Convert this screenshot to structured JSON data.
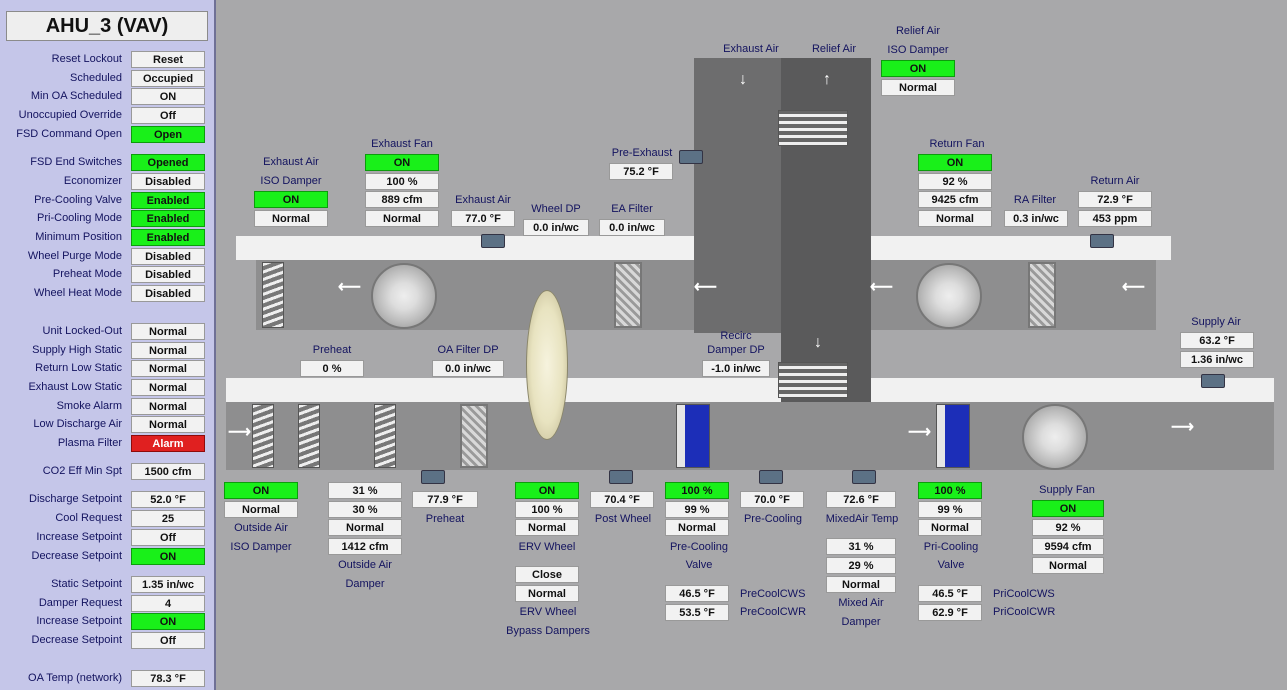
{
  "title": "AHU_3 (VAV)",
  "left": [
    {
      "label": "Reset Lockout",
      "value": "Reset",
      "style": "btn"
    },
    {
      "label": "Scheduled",
      "value": "Occupied",
      "style": "normal"
    },
    {
      "label": "Min OA Scheduled",
      "value": "ON",
      "style": "normal"
    },
    {
      "label": "Unoccupied Override",
      "value": "Off",
      "style": "normal"
    },
    {
      "label": "FSD Command Open",
      "value": "Open",
      "style": "green"
    },
    {
      "label": "FSD End Switches",
      "value": "Opened",
      "style": "green"
    },
    {
      "label": "Economizer",
      "value": "Disabled",
      "style": "normal"
    },
    {
      "label": "Pre-Cooling Valve",
      "value": "Enabled",
      "style": "green"
    },
    {
      "label": "Pri-Cooling Mode",
      "value": "Enabled",
      "style": "green"
    },
    {
      "label": "Minimum Position",
      "value": "Enabled",
      "style": "green"
    },
    {
      "label": "Wheel Purge Mode",
      "value": "Disabled",
      "style": "normal"
    },
    {
      "label": "Preheat Mode",
      "value": "Disabled",
      "style": "normal"
    },
    {
      "label": "Wheel Heat Mode",
      "value": "Disabled",
      "style": "normal"
    },
    {
      "label": "Unit Locked-Out",
      "value": "Normal",
      "style": "normal"
    },
    {
      "label": "Supply High Static",
      "value": "Normal",
      "style": "normal"
    },
    {
      "label": "Return Low Static",
      "value": "Normal",
      "style": "normal"
    },
    {
      "label": "Exhaust Low Static",
      "value": "Normal",
      "style": "normal"
    },
    {
      "label": "Smoke Alarm",
      "value": "Normal",
      "style": "normal"
    },
    {
      "label": "Low Discharge Air",
      "value": "Normal",
      "style": "normal"
    },
    {
      "label": "Plasma Filter",
      "value": "Alarm",
      "style": "red"
    },
    {
      "label": "CO2 Eff Min Spt",
      "value": "1500 cfm",
      "style": "normal"
    },
    {
      "label": "Discharge Setpoint",
      "value": "52.0 °F",
      "style": "normal"
    },
    {
      "label": "Cool Request",
      "value": "25",
      "style": "normal"
    },
    {
      "label": "Increase Setpoint",
      "value": "Off",
      "style": "normal"
    },
    {
      "label": "Decrease Setpoint",
      "value": "ON",
      "style": "green"
    },
    {
      "label": "Static Setpoint",
      "value": "1.35 in/wc",
      "style": "normal"
    },
    {
      "label": "Damper Request",
      "value": "4",
      "style": "normal"
    },
    {
      "label": "Increase Setpoint",
      "value": "ON",
      "style": "green"
    },
    {
      "label": "Decrease Setpoint",
      "value": "Off",
      "style": "normal"
    },
    {
      "label": "OA Temp (network)",
      "value": "78.3 °F",
      "style": "normal"
    }
  ],
  "diagram": {
    "labels": {
      "exhaust_air_col": "Exhaust Air",
      "relief_air_col": "Relief Air",
      "relief_iso_1": "Relief Air",
      "relief_iso_2": "ISO Damper",
      "exhaust_iso_1": "Exhaust Air",
      "exhaust_iso_2": "ISO Damper",
      "exhaust_fan": "Exhaust Fan",
      "exhaust_air_temp": "Exhaust Air",
      "wheel_dp": "Wheel DP",
      "ea_filter": "EA Filter",
      "pre_exhaust": "Pre-Exhaust",
      "return_fan": "Return Fan",
      "ra_filter": "RA Filter",
      "return_air": "Return Air",
      "supply_air": "Supply Air",
      "preheat_top": "Preheat",
      "oa_filter_dp": "OA Filter DP",
      "recirc_dp_1": "Recirc",
      "recirc_dp_2": "Damper DP",
      "outside_air_iso_1": "Outside Air",
      "outside_air_iso_2": "ISO Damper",
      "outside_air_damper_1": "Outside Air",
      "outside_air_damper_2": "Damper",
      "preheat_bottom": "Preheat",
      "erv_wheel": "ERV Wheel",
      "post_wheel": "Post Wheel",
      "pre_cooling_valve_1": "Pre-Cooling",
      "pre_cooling_valve_2": "Valve",
      "pre_cooling_temp": "Pre-Cooling",
      "mixed_air_temp": "MixedAir Temp",
      "mixed_air_damper_1": "Mixed Air",
      "mixed_air_damper_2": "Damper",
      "pri_cooling_valve_1": "Pri-Cooling",
      "pri_cooling_valve_2": "Valve",
      "supply_fan": "Supply Fan",
      "erv_bypass_1": "ERV Wheel",
      "erv_bypass_2": "Bypass Dampers",
      "precool_cws": "PreCoolCWS",
      "precool_cwr": "PreCoolCWR",
      "pricool_cws": "PriCoolCWS",
      "pricool_cwr": "PriCoolCWR"
    },
    "values": {
      "relief_iso_status": "ON",
      "relief_iso_alarm": "Normal",
      "exhaust_iso_status": "ON",
      "exhaust_iso_alarm": "Normal",
      "exhaust_fan_status": "ON",
      "exhaust_fan_speed": "100 %",
      "exhaust_fan_cfm": "889 cfm",
      "exhaust_fan_alarm": "Normal",
      "exhaust_air_temp": "77.0 °F",
      "wheel_dp": "0.0 in/wc",
      "ea_filter": "0.0 in/wc",
      "pre_exhaust": "75.2 °F",
      "return_fan_status": "ON",
      "return_fan_speed": "92 %",
      "return_fan_cfm": "9425 cfm",
      "return_fan_alarm": "Normal",
      "ra_filter": "0.3 in/wc",
      "return_air_temp": "72.9 °F",
      "return_air_co2": "453 ppm",
      "supply_air_temp": "63.2 °F",
      "supply_air_static": "1.36 in/wc",
      "preheat_pct": "0 %",
      "oa_filter_dp": "0.0 in/wc",
      "recirc_dp": "-1.0 in/wc",
      "oa_iso_status": "ON",
      "oa_iso_alarm": "Normal",
      "oa_damper_cmd": "31 %",
      "oa_damper_fb": "30 %",
      "oa_damper_alarm": "Normal",
      "oa_damper_cfm": "1412 cfm",
      "preheat_temp": "77.9 °F",
      "erv_status": "ON",
      "erv_speed": "100 %",
      "erv_alarm": "Normal",
      "post_wheel_temp": "70.4 °F",
      "pre_cooling_valve_cmd": "100 %",
      "pre_cooling_valve_fb": "99 %",
      "pre_cooling_valve_alarm": "Normal",
      "pre_cooling_temp": "70.0 °F",
      "mixed_air_temp": "72.6 °F",
      "mixed_damper_cmd": "31 %",
      "mixed_damper_fb": "29 %",
      "mixed_damper_alarm": "Normal",
      "pri_cooling_valve_cmd": "100 %",
      "pri_cooling_valve_fb": "99 %",
      "pri_cooling_valve_alarm": "Normal",
      "supply_fan_status": "ON",
      "supply_fan_speed": "92 %",
      "supply_fan_cfm": "9594 cfm",
      "supply_fan_alarm": "Normal",
      "erv_bypass_cmd": "Close",
      "erv_bypass_alarm": "Normal",
      "precool_cws": "46.5 °F",
      "precool_cwr": "53.5 °F",
      "pricool_cws": "46.5 °F",
      "pricool_cwr": "62.9 °F"
    }
  }
}
